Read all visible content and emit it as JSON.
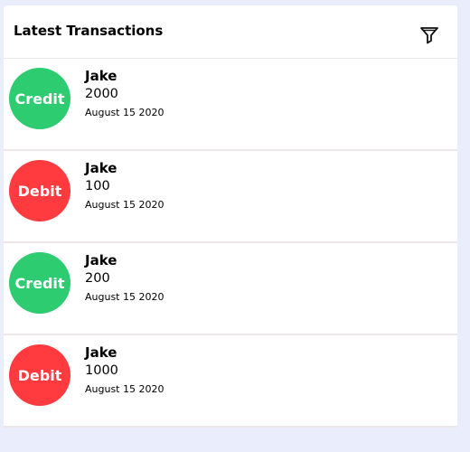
{
  "header": {
    "title": "Latest Transactions",
    "filter_icon": "filter-icon"
  },
  "colors": {
    "credit": "#2ecc71",
    "debit": "#ff3b3f",
    "background": "#eaedfb",
    "card": "#ffffff"
  },
  "transactions": [
    {
      "type": "Credit",
      "name": "Jake",
      "amount": "2000",
      "date": "August 15 2020"
    },
    {
      "type": "Debit",
      "name": "Jake",
      "amount": "100",
      "date": "August 15 2020"
    },
    {
      "type": "Credit",
      "name": "Jake",
      "amount": "200",
      "date": "August 15 2020"
    },
    {
      "type": "Debit",
      "name": "Jake",
      "amount": "1000",
      "date": "August 15 2020"
    }
  ]
}
